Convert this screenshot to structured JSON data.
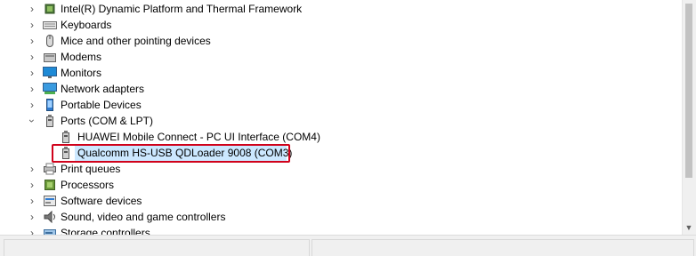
{
  "tree": {
    "items": [
      {
        "label": "Intel(R) Dynamic Platform and Thermal Framework",
        "icon": "chip-icon"
      },
      {
        "label": "Keyboards",
        "icon": "keyboard-icon"
      },
      {
        "label": "Mice and other pointing devices",
        "icon": "mouse-icon"
      },
      {
        "label": "Modems",
        "icon": "modem-icon"
      },
      {
        "label": "Monitors",
        "icon": "monitor-icon"
      },
      {
        "label": "Network adapters",
        "icon": "network-adapter-icon"
      },
      {
        "label": "Portable Devices",
        "icon": "portable-device-icon"
      },
      {
        "label": "Ports (COM & LPT)",
        "icon": "port-icon",
        "expanded": true
      },
      {
        "label": "Print queues",
        "icon": "printer-icon"
      },
      {
        "label": "Processors",
        "icon": "processor-icon"
      },
      {
        "label": "Software devices",
        "icon": "software-device-icon"
      },
      {
        "label": "Sound, video and game controllers",
        "icon": "speaker-icon"
      },
      {
        "label": "Storage controllers",
        "icon": "storage-controller-icon"
      }
    ],
    "ports_children": [
      {
        "label": "HUAWEI Mobile Connect - PC UI Interface (COM4)",
        "icon": "port-device-icon"
      },
      {
        "label": "Qualcomm HS-USB QDLoader 9008 (COM3)",
        "icon": "port-device-icon",
        "selected": true
      }
    ]
  },
  "colors": {
    "selection": "#cce8ff",
    "highlight_border": "#d0021b",
    "scrollbar_thumb": "#c2c2c2"
  }
}
